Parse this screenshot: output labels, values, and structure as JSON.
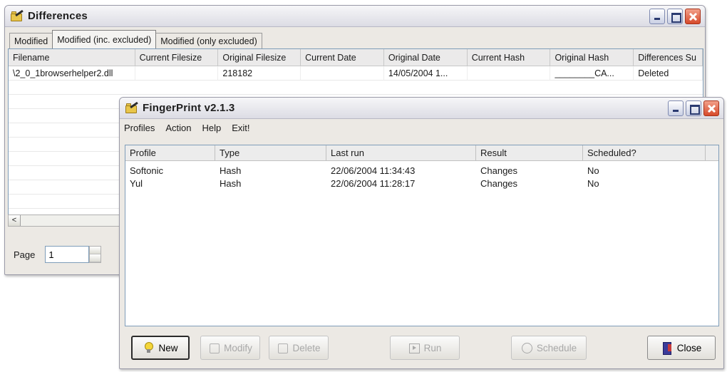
{
  "differences": {
    "title": "Differences",
    "tabs": [
      "Modified",
      "Modified (inc. excluded)",
      "Modified (only excluded)"
    ],
    "columns": [
      "Filename",
      "Current Filesize",
      "Original Filesize",
      "Current Date",
      "Original Date",
      "Current Hash",
      "Original Hash",
      "Differences Su"
    ],
    "rows": [
      [
        "\\2_0_1browserhelper2.dll",
        "",
        "218182",
        "",
        "14/05/2004 1...",
        "",
        "________CA...",
        "Deleted"
      ]
    ],
    "scroll_left": "<",
    "page_label": "Page",
    "page_value": "1"
  },
  "fingerprint": {
    "title": "FingerPrint v2.1.3",
    "menu": [
      "Profiles",
      "Action",
      "Help",
      "Exit!"
    ],
    "columns": [
      "Profile",
      "Type",
      "Last run",
      "Result",
      "Scheduled?"
    ],
    "rows": [
      [
        "Softonic",
        "Hash",
        "22/06/2004 11:34:43",
        "Changes",
        "No"
      ],
      [
        "Yul",
        "Hash",
        "22/06/2004 11:28:17",
        "Changes",
        "No"
      ]
    ],
    "buttons": {
      "new": "New",
      "modify": "Modify",
      "delete": "Delete",
      "run": "Run",
      "schedule": "Schedule",
      "close": "Close"
    }
  },
  "icons": {
    "window": "folder-pen-icon",
    "new": "lightbulb-icon",
    "close": "door-exit-icon"
  }
}
